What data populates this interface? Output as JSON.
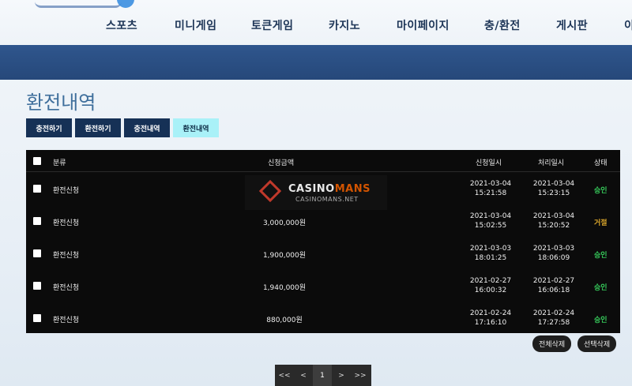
{
  "nav": {
    "items": [
      "스포츠",
      "미니게임",
      "토큰게임",
      "카지노",
      "마이페이지",
      "충/환전",
      "게시판",
      "이"
    ]
  },
  "page": {
    "title": "환전내역"
  },
  "tabs": [
    "충전하기",
    "환전하기",
    "충전내역",
    "환전내역"
  ],
  "active_tab": "환전내역",
  "table": {
    "headers": [
      "분류",
      "신청금액",
      "신청일시",
      "처리일시",
      "상태"
    ],
    "rows": [
      {
        "type": "환전신청",
        "amount": "",
        "req_date": "2021-03-04",
        "req_time": "15:21:58",
        "proc_date": "2021-03-04",
        "proc_time": "15:23:15",
        "status": "승인"
      },
      {
        "type": "환전신청",
        "amount": "3,000,000원",
        "req_date": "2021-03-04",
        "req_time": "15:02:55",
        "proc_date": "2021-03-04",
        "proc_time": "15:20:52",
        "status": "거절"
      },
      {
        "type": "환전신청",
        "amount": "1,900,000원",
        "req_date": "2021-03-03",
        "req_time": "18:01:25",
        "proc_date": "2021-03-03",
        "proc_time": "18:06:09",
        "status": "승인"
      },
      {
        "type": "환전신청",
        "amount": "1,940,000원",
        "req_date": "2021-02-27",
        "req_time": "16:00:32",
        "proc_date": "2021-02-27",
        "proc_time": "16:06:18",
        "status": "승인"
      },
      {
        "type": "환전신청",
        "amount": "880,000원",
        "req_date": "2021-02-24",
        "req_time": "17:16:10",
        "proc_date": "2021-02-24",
        "proc_time": "17:27:58",
        "status": "승인"
      }
    ]
  },
  "watermark": {
    "brand_a": "CASINO",
    "brand_b": "MANS",
    "sub": "CASINOMANS.NET"
  },
  "actions": {
    "delete_all": "전체삭제",
    "delete_selected": "선택삭제"
  },
  "pagination": {
    "first": "<<",
    "prev": "<",
    "current": "1",
    "next": ">",
    "last": ">>"
  },
  "colors": {
    "approved": "#35c759",
    "rejected": "#d9a52b",
    "active_tab": "#a9f1f8",
    "tab": "#163156",
    "bar": "#2f568d"
  }
}
